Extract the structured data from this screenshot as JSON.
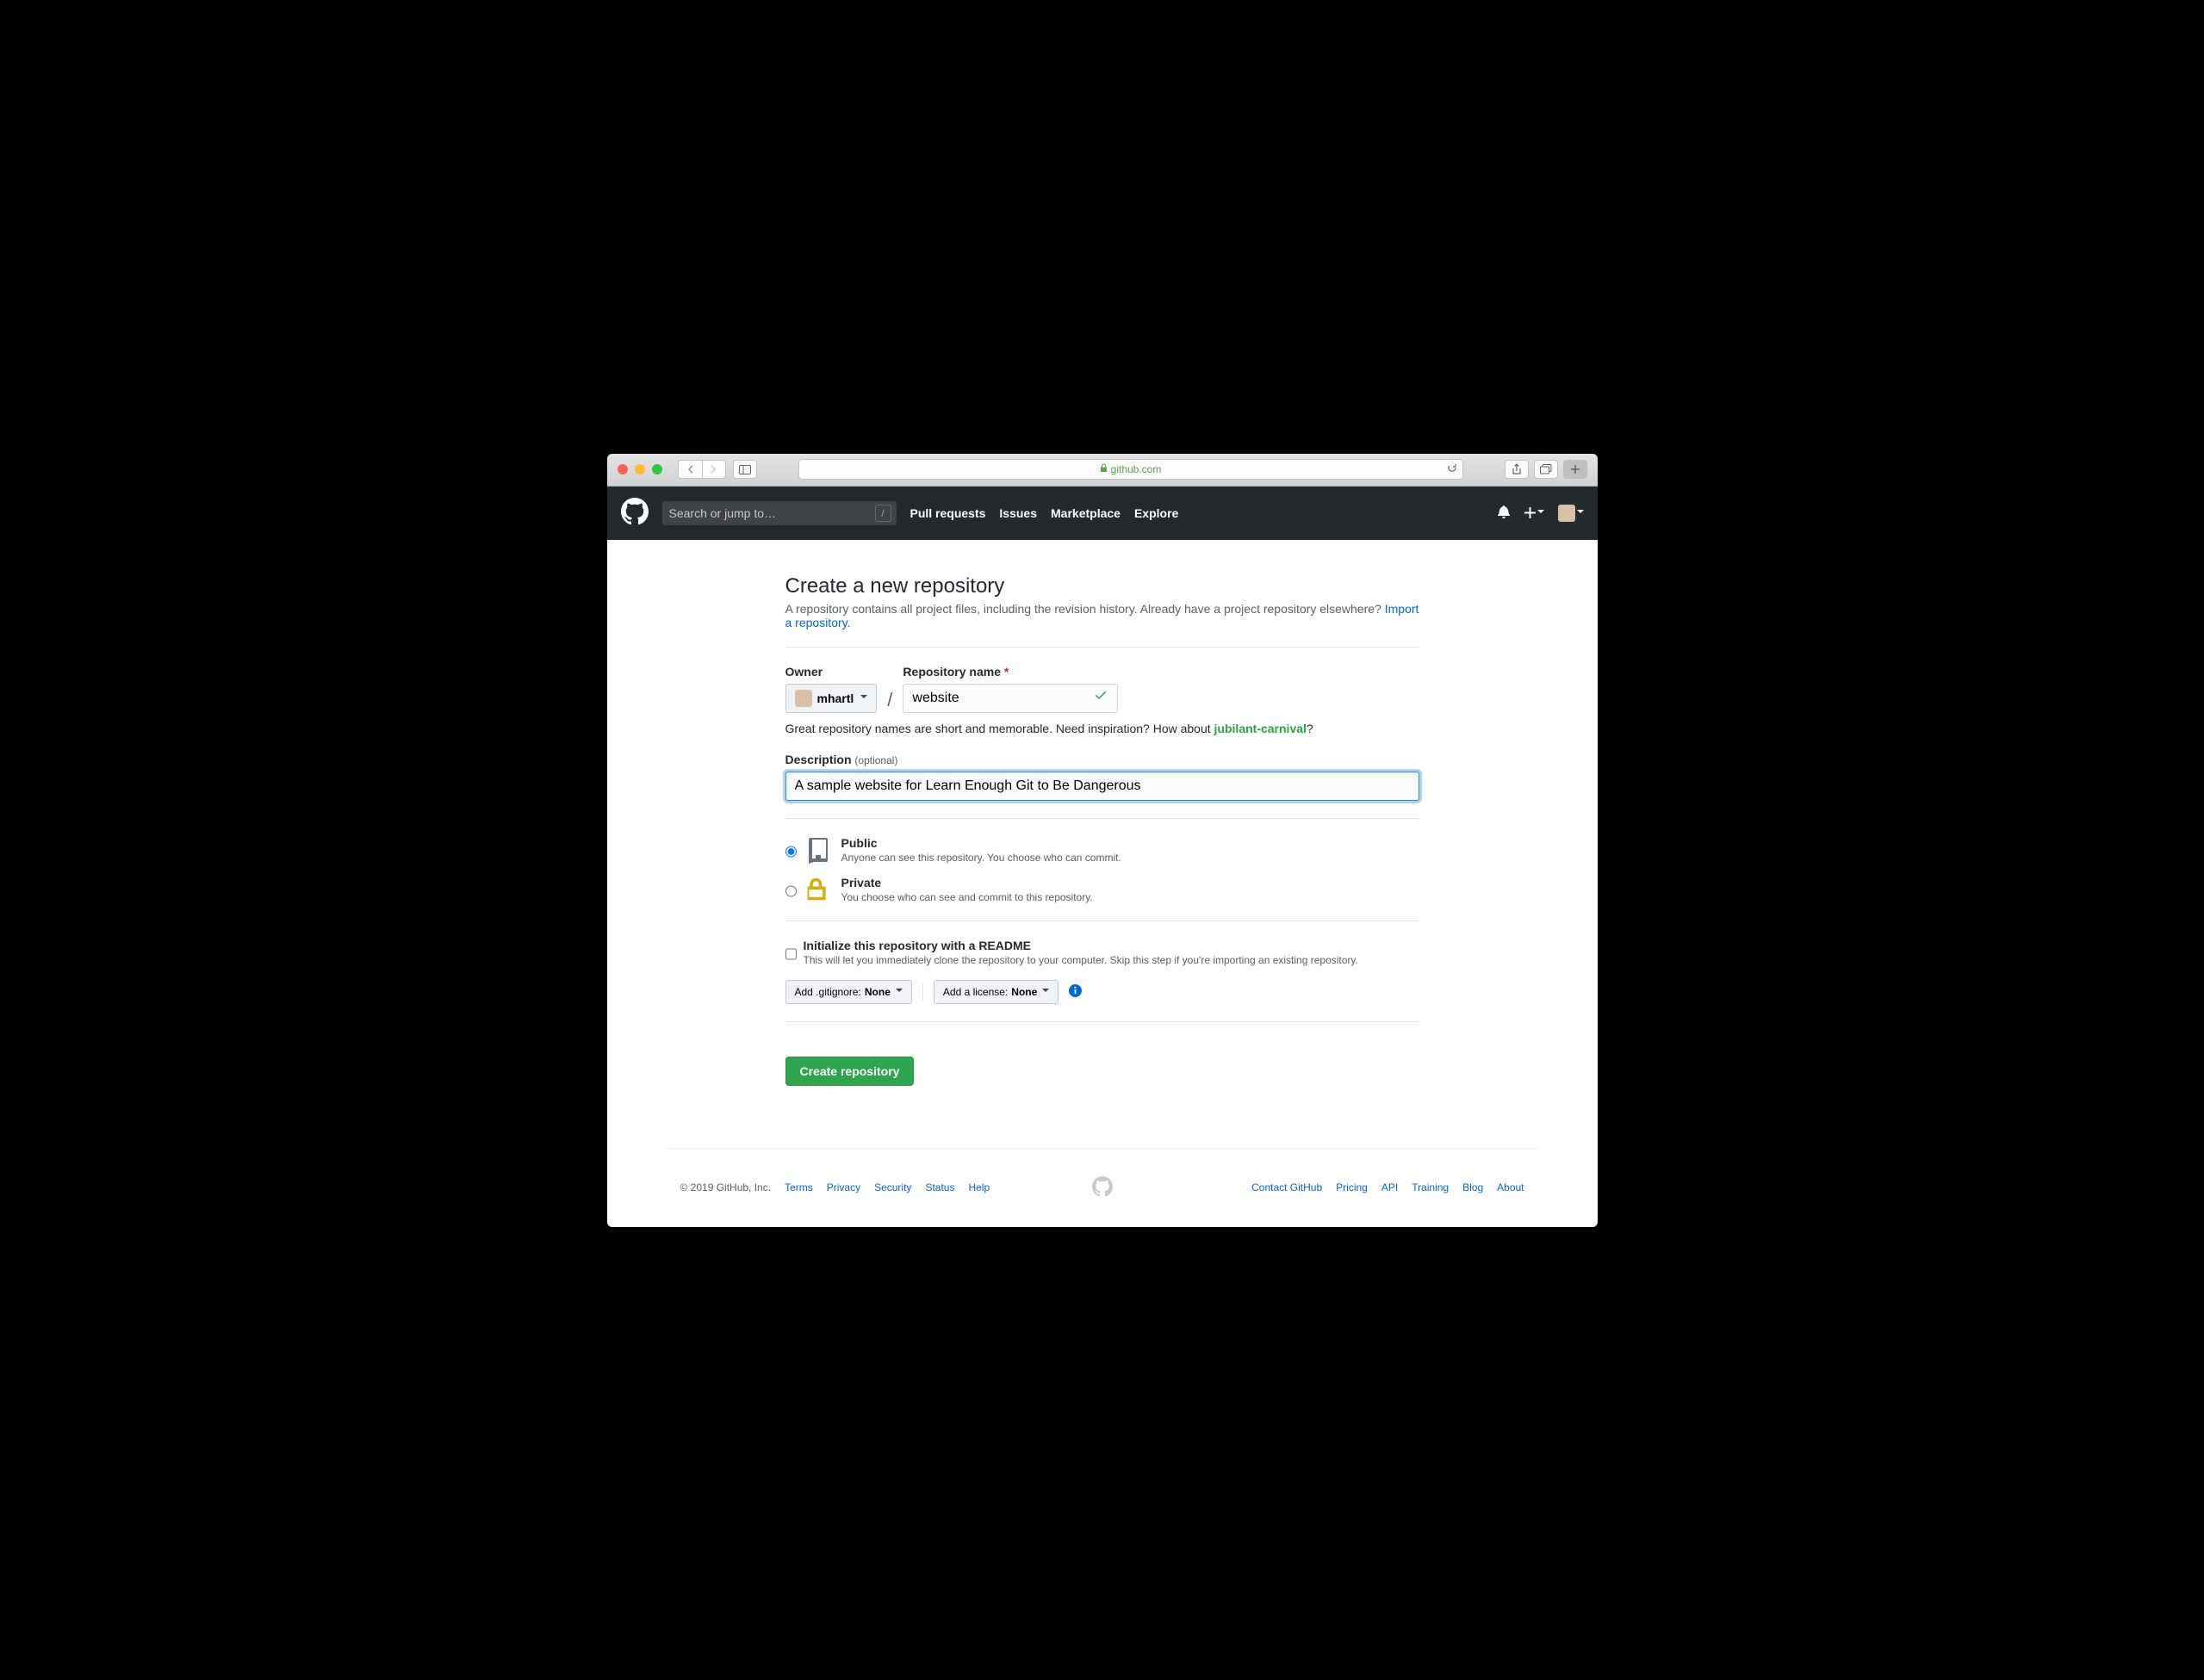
{
  "browser": {
    "domain": "github.com"
  },
  "header": {
    "search_placeholder": "Search or jump to…",
    "slash_key": "/",
    "nav": [
      "Pull requests",
      "Issues",
      "Marketplace",
      "Explore"
    ]
  },
  "page": {
    "title": "Create a new repository",
    "subhead_before": "A repository contains all project files, including the revision history. Already have a project repository elsewhere? ",
    "subhead_link": "Import a repository",
    "subhead_after": "."
  },
  "form": {
    "owner_label": "Owner",
    "owner_value": "mhartl",
    "reponame_label": "Repository name",
    "reponame_value": "website",
    "inspire_before": "Great repository names are short and memorable. Need inspiration? How about ",
    "inspire_suggestion": "jubilant-carnival",
    "inspire_after": "?",
    "desc_label": "Description",
    "desc_optional": "(optional)",
    "desc_value": "A sample website for Learn Enough Git to Be Dangerous",
    "visibility": {
      "public_title": "Public",
      "public_desc": "Anyone can see this repository. You choose who can commit.",
      "private_title": "Private",
      "private_desc": "You choose who can see and commit to this repository."
    },
    "readme_title": "Initialize this repository with a README",
    "readme_desc": "This will let you immediately clone the repository to your computer. Skip this step if you're importing an existing repository.",
    "gitignore_label_pre": "Add .gitignore: ",
    "gitignore_value": "None",
    "license_label_pre": "Add a license: ",
    "license_value": "None",
    "submit": "Create repository"
  },
  "footer": {
    "copyright": "© 2019 GitHub, Inc.",
    "left": [
      "Terms",
      "Privacy",
      "Security",
      "Status",
      "Help"
    ],
    "right": [
      "Contact GitHub",
      "Pricing",
      "API",
      "Training",
      "Blog",
      "About"
    ]
  }
}
